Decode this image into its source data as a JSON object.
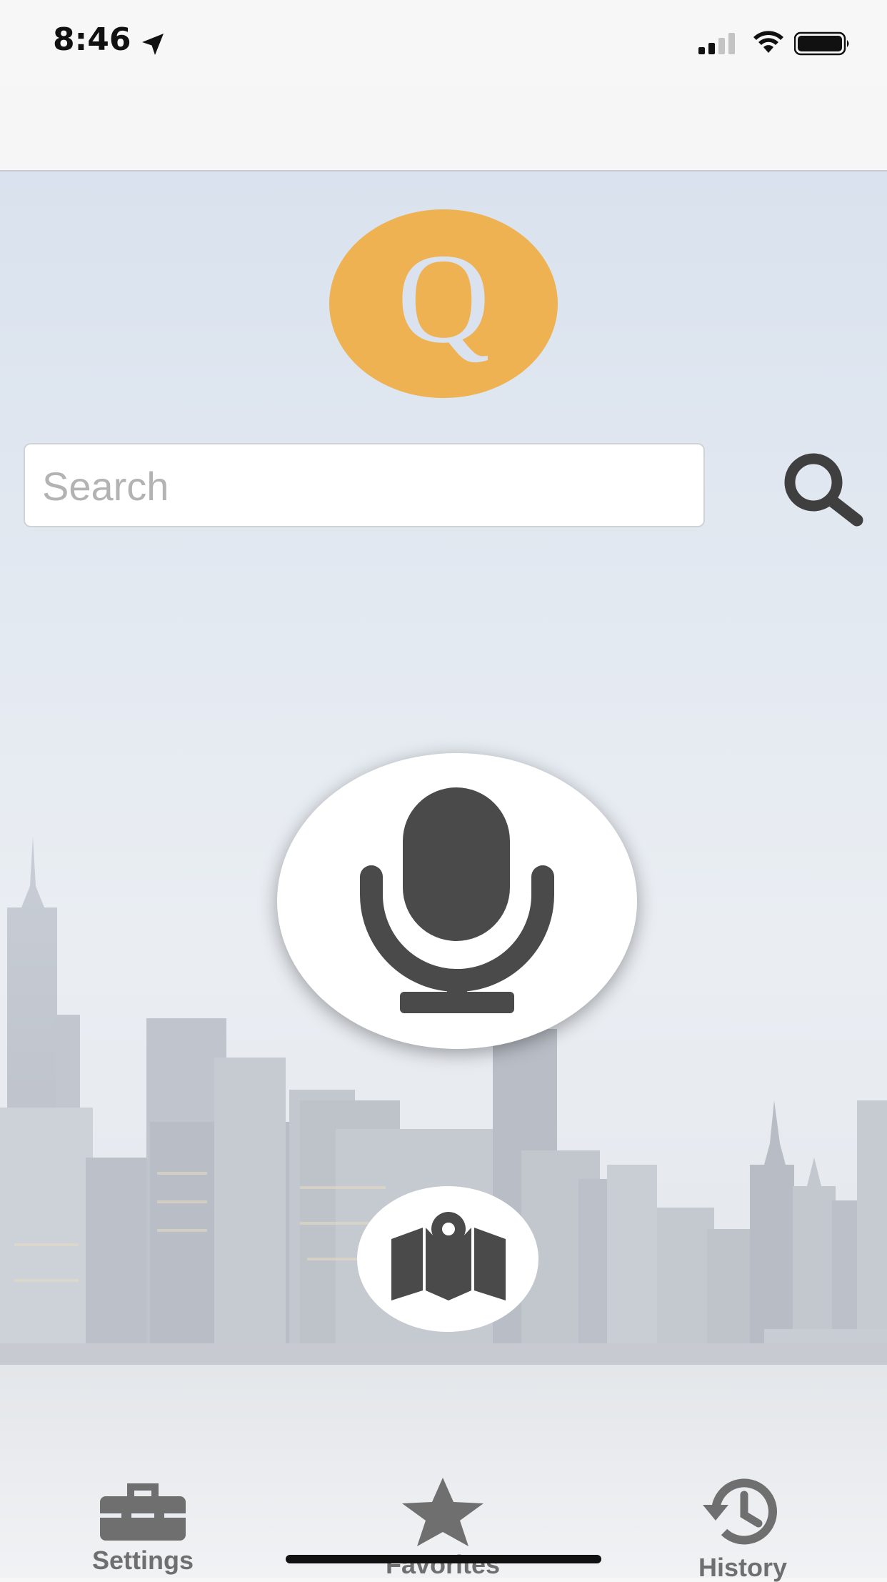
{
  "status_bar": {
    "time": "8:46",
    "icons": [
      "location-arrow-icon",
      "cellular-signal-icon",
      "wifi-icon",
      "battery-icon"
    ]
  },
  "logo": {
    "letter": "Q",
    "color": "#efb252"
  },
  "search": {
    "placeholder": "Search",
    "value": ""
  },
  "actions": {
    "mic_icon": "microphone-icon",
    "map_icon": "map-pin-icon"
  },
  "tab_bar": {
    "items": [
      {
        "label": "Settings",
        "icon": "toolbox-icon"
      },
      {
        "label": "Favorites",
        "icon": "star-icon"
      },
      {
        "label": "History",
        "icon": "history-clock-icon"
      }
    ]
  },
  "colors": {
    "accent": "#efb252",
    "icon_gray": "#4a4a4a",
    "tab_gray": "#6f6f6f"
  }
}
